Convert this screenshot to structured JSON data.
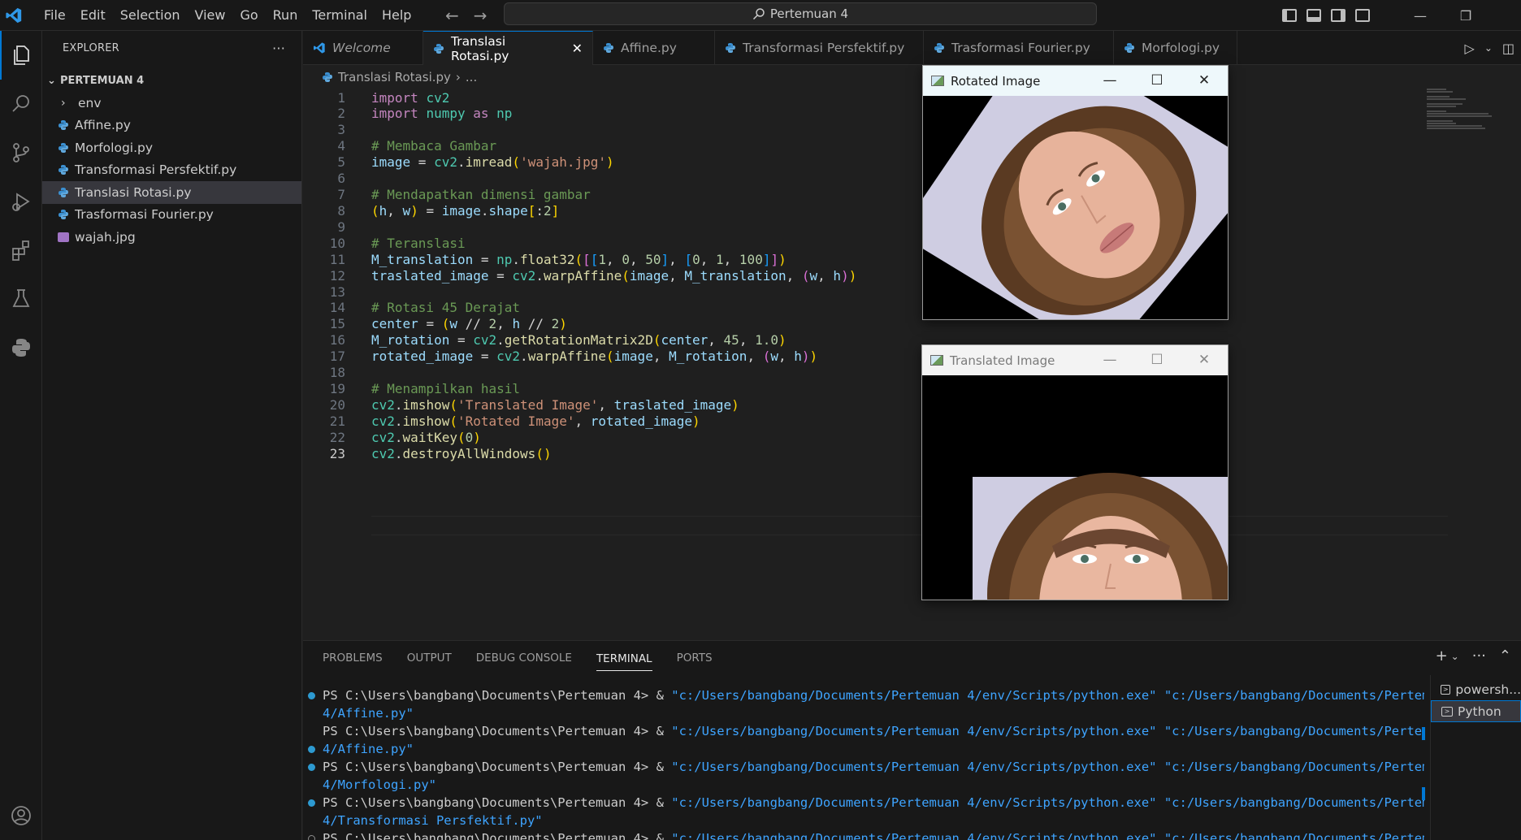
{
  "menu": [
    "File",
    "Edit",
    "Selection",
    "View",
    "Go",
    "Run",
    "Terminal",
    "Help"
  ],
  "command_center": "Pertemuan 4",
  "explorer": {
    "title": "EXPLORER",
    "more": "···",
    "root": "PERTEMUAN 4",
    "items": [
      {
        "label": "env",
        "kind": "folder"
      },
      {
        "label": "Affine.py",
        "kind": "python"
      },
      {
        "label": "Morfologi.py",
        "kind": "python"
      },
      {
        "label": "Transformasi Persfektif.py",
        "kind": "python"
      },
      {
        "label": "Translasi Rotasi.py",
        "kind": "python",
        "selected": true
      },
      {
        "label": "Trasformasi Fourier.py",
        "kind": "python"
      },
      {
        "label": "wajah.jpg",
        "kind": "image"
      }
    ]
  },
  "tabs": [
    {
      "label": "Welcome"
    },
    {
      "label": "Translasi Rotasi.py",
      "active": true
    },
    {
      "label": "Affine.py"
    },
    {
      "label": "Transformasi Persfektif.py"
    },
    {
      "label": "Trasformasi Fourier.py"
    },
    {
      "label": "Morfologi.py"
    }
  ],
  "breadcrumb": {
    "file": "Translasi Rotasi.py",
    "rest": "..."
  },
  "editor": {
    "current_line": 23,
    "lines": [
      "import cv2",
      "import numpy as np",
      "",
      "# Membaca Gambar",
      "image = cv2.imread('wajah.jpg')",
      "",
      "# Mendapatkan dimensi gambar",
      "(h, w) = image.shape[:2]",
      "",
      "# Teranslasi",
      "M_translation = np.float32([[1, 0, 50], [0, 1, 100]])",
      "traslated_image = cv2.warpAffine(image, M_translation, (w, h))",
      "",
      "# Rotasi 45 Derajat",
      "center = (w // 2, h // 2)",
      "M_rotation = cv2.getRotationMatrix2D(center, 45, 1.0)",
      "rotated_image = cv2.warpAffine(image, M_rotation, (w, h))",
      "",
      "# Menampilkan hasil",
      "cv2.imshow('Translated Image', traslated_image)",
      "cv2.imshow('Rotated Image', rotated_image)",
      "cv2.waitKey(0)",
      "cv2.destroyAllWindows()"
    ]
  },
  "windows": {
    "rotated": {
      "title": "Rotated Image",
      "minimize": "—",
      "maximize": "☐",
      "close": "✕"
    },
    "translated": {
      "title": "Translated Image",
      "minimize": "—",
      "maximize": "☐",
      "close": "✕"
    }
  },
  "panel": {
    "tabs": [
      "PROBLEMS",
      "OUTPUT",
      "DEBUG CONSOLE",
      "TERMINAL",
      "PORTS"
    ],
    "active_tab": "TERMINAL",
    "terminals": [
      "powersh...",
      "Python"
    ],
    "lines": [
      {
        "prompt": "PS C:\\Users\\bangbang\\Documents\\Pertemuan 4> & ",
        "cmd": "\"c:/Users/bangbang/Documents/Pertemuan 4/env/Scripts/python.exe\" \"c:/Users/bangbang/Documents/Pertemuan",
        "dot": "filled"
      },
      {
        "prompt": "",
        "cmd": "4/Affine.py\"",
        "dot": "none"
      },
      {
        "prompt": "PS C:\\Users\\bangbang\\Documents\\Pertemuan 4> & ",
        "cmd": "\"c:/Users/bangbang/Documents/Pertemuan 4/env/Scripts/python.exe\" \"c:/Users/bangbang/Documents/Pertemuan",
        "dot": "none"
      },
      {
        "prompt": "",
        "cmd": "4/Affine.py\"",
        "dot": "filled"
      },
      {
        "prompt": "PS C:\\Users\\bangbang\\Documents\\Pertemuan 4> & ",
        "cmd": "\"c:/Users/bangbang/Documents/Pertemuan 4/env/Scripts/python.exe\" \"c:/Users/bangbang/Documents/Pertemuan",
        "dot": "filled"
      },
      {
        "prompt": "",
        "cmd": "4/Morfologi.py\"",
        "dot": "none"
      },
      {
        "prompt": "PS C:\\Users\\bangbang\\Documents\\Pertemuan 4> & ",
        "cmd": "\"c:/Users/bangbang/Documents/Pertemuan 4/env/Scripts/python.exe\" \"c:/Users/bangbang/Documents/Pertemuan",
        "dot": "filled"
      },
      {
        "prompt": "",
        "cmd": "4/Transformasi Persfektif.py\"",
        "dot": "none"
      },
      {
        "prompt": "PS C:\\Users\\bangbang\\Documents\\Pertemuan 4> & ",
        "cmd": "\"c:/Users/bangbang/Documents/Pertemuan 4/env/Scripts/python.exe\" \"c:/Users/bangbang/Documents/Pertemuan",
        "dot": "hollow"
      }
    ]
  },
  "colors": {
    "accent": "#0078d4",
    "background": "#1f1f1f",
    "sidebar": "#181818"
  }
}
